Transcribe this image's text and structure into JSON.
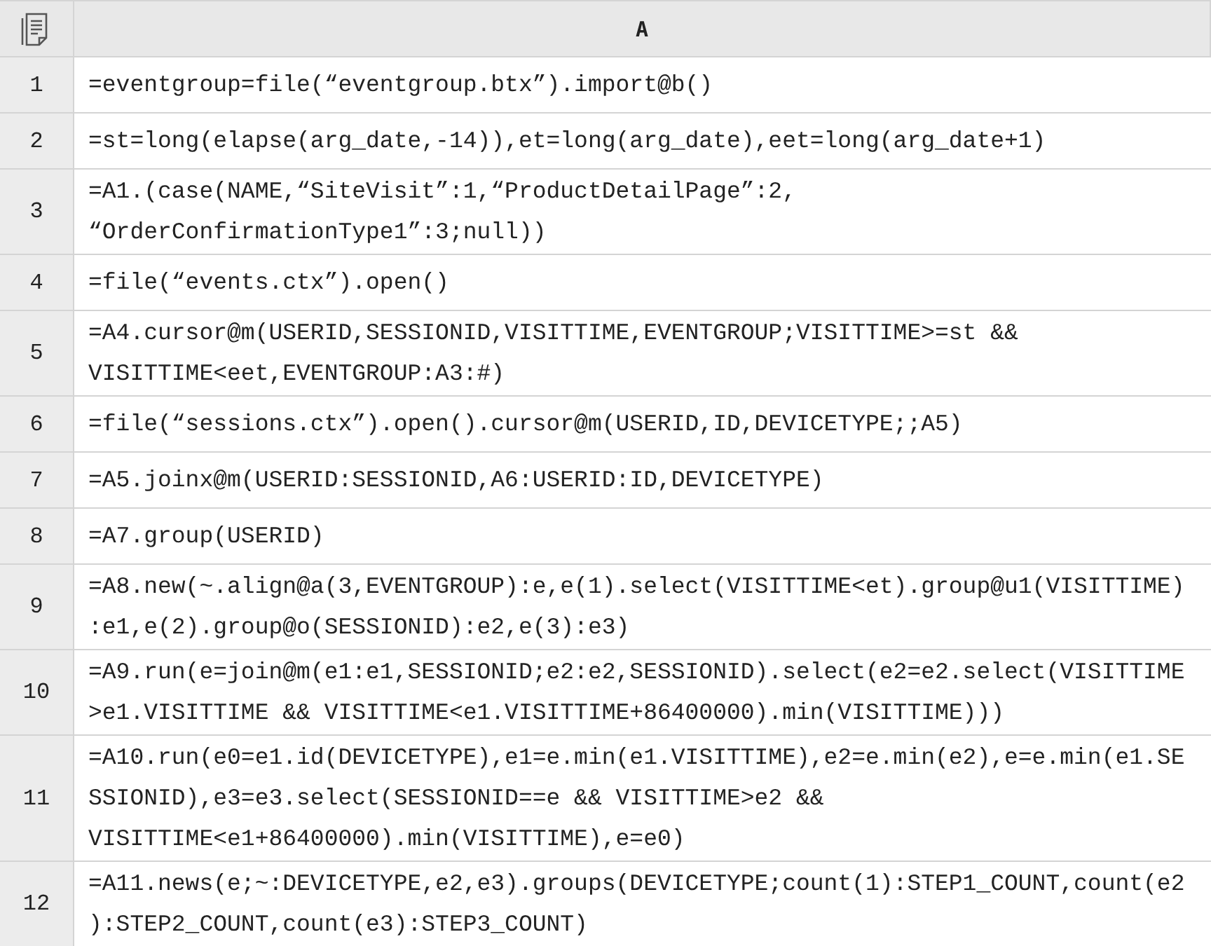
{
  "sheet": {
    "column_header": "A",
    "rows": [
      {
        "number": "1",
        "formula": "=eventgroup=file(“eventgroup.btx”).import@b()"
      },
      {
        "number": "2",
        "formula": "=st=long(elapse(arg_date,-14)),et=long(arg_date),eet=long(arg_date+1)"
      },
      {
        "number": "3",
        "formula": "=A1.(case(NAME,“SiteVisit”:1,“ProductDetailPage”:2, “OrderConfirmationType1”:3;null))"
      },
      {
        "number": "4",
        "formula": "=file(“events.ctx”).open()"
      },
      {
        "number": "5",
        "formula": "=A4.cursor@m(USERID,SESSIONID,VISITTIME,EVENTGROUP;VISITTIME>=st && VISITTIME<eet,EVENTGROUP:A3:#)"
      },
      {
        "number": "6",
        "formula": "=file(“sessions.ctx”).open().cursor@m(USERID,ID,DEVICETYPE;;A5)"
      },
      {
        "number": "7",
        "formula": "=A5.joinx@m(USERID:SESSIONID,A6:USERID:ID,DEVICETYPE)"
      },
      {
        "number": "8",
        "formula": "=A7.group(USERID)"
      },
      {
        "number": "9",
        "formula": "=A8.new(~.align@a(3,EVENTGROUP):e,e(1).select(VISITTIME<et).group@u1(VISITTIME):e1,e(2).group@o(SESSIONID):e2,e(3):e3)"
      },
      {
        "number": "10",
        "formula": "=A9.run(e=join@m(e1:e1,SESSIONID;e2:e2,SESSIONID).select(e2=e2.select(VISITTIME>e1.VISITTIME && VISITTIME<e1.VISITTIME+86400000).min(VISITTIME)))"
      },
      {
        "number": "11",
        "formula": "=A10.run(e0=e1.id(DEVICETYPE),e1=e.min(e1.VISITTIME),e2=e.min(e2),e=e.min(e1.SESSIONID),e3=e3.select(SESSIONID==e && VISITTIME>e2 && VISITTIME<e1+86400000).min(VISITTIME),e=e0)"
      },
      {
        "number": "12",
        "formula": "=A11.news(e;~:DEVICETYPE,e2,e3).groups(DEVICETYPE;count(1):STEP1_COUNT,count(e2):STEP2_COUNT,count(e3):STEP3_COUNT)"
      }
    ]
  }
}
